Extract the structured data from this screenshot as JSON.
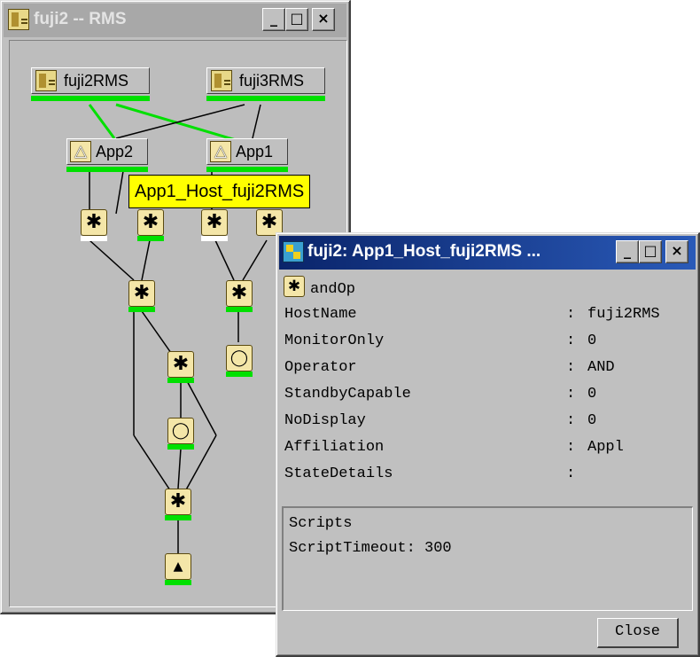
{
  "graph_window": {
    "title": "fuji2 -- RMS",
    "buttons": {
      "minimize": "_",
      "maximize": "□",
      "close": "×"
    },
    "nodes": {
      "server1": "fuji2RMS",
      "server2": "fuji3RMS",
      "app_a": "App2",
      "app_b": "App1"
    },
    "tooltip": "App1_Host_fuji2RMS",
    "resource_glyphs": {
      "star": "✱",
      "circle": "◯",
      "cmd": "▲"
    }
  },
  "detail_window": {
    "title": "fuji2: App1_Host_fuji2RMS ...",
    "buttons": {
      "minimize": "_",
      "maximize": "□",
      "close": "×"
    },
    "header_label": "andOp",
    "properties": [
      {
        "key": "HostName",
        "value": "fuji2RMS"
      },
      {
        "key": "MonitorOnly",
        "value": "0"
      },
      {
        "key": "Operator",
        "value": "AND"
      },
      {
        "key": "StandbyCapable",
        "value": "0"
      },
      {
        "key": "NoDisplay",
        "value": "0"
      },
      {
        "key": "Affiliation",
        "value": "Appl"
      },
      {
        "key": "StateDetails",
        "value": ""
      }
    ],
    "separator": ":",
    "scripts": {
      "heading": "Scripts",
      "timeout": "ScriptTimeout: 300"
    },
    "close_button": "Close"
  },
  "colors": {
    "online": "#00e000",
    "tooltip_bg": "#ffff00",
    "title_active": "#0a246a",
    "title_inactive": "#a8a8a8"
  },
  "icons": [
    "server-icon",
    "application-icon",
    "and-resource-icon",
    "gateway-resource-icon",
    "command-resource-icon",
    "rms-app-icon"
  ]
}
